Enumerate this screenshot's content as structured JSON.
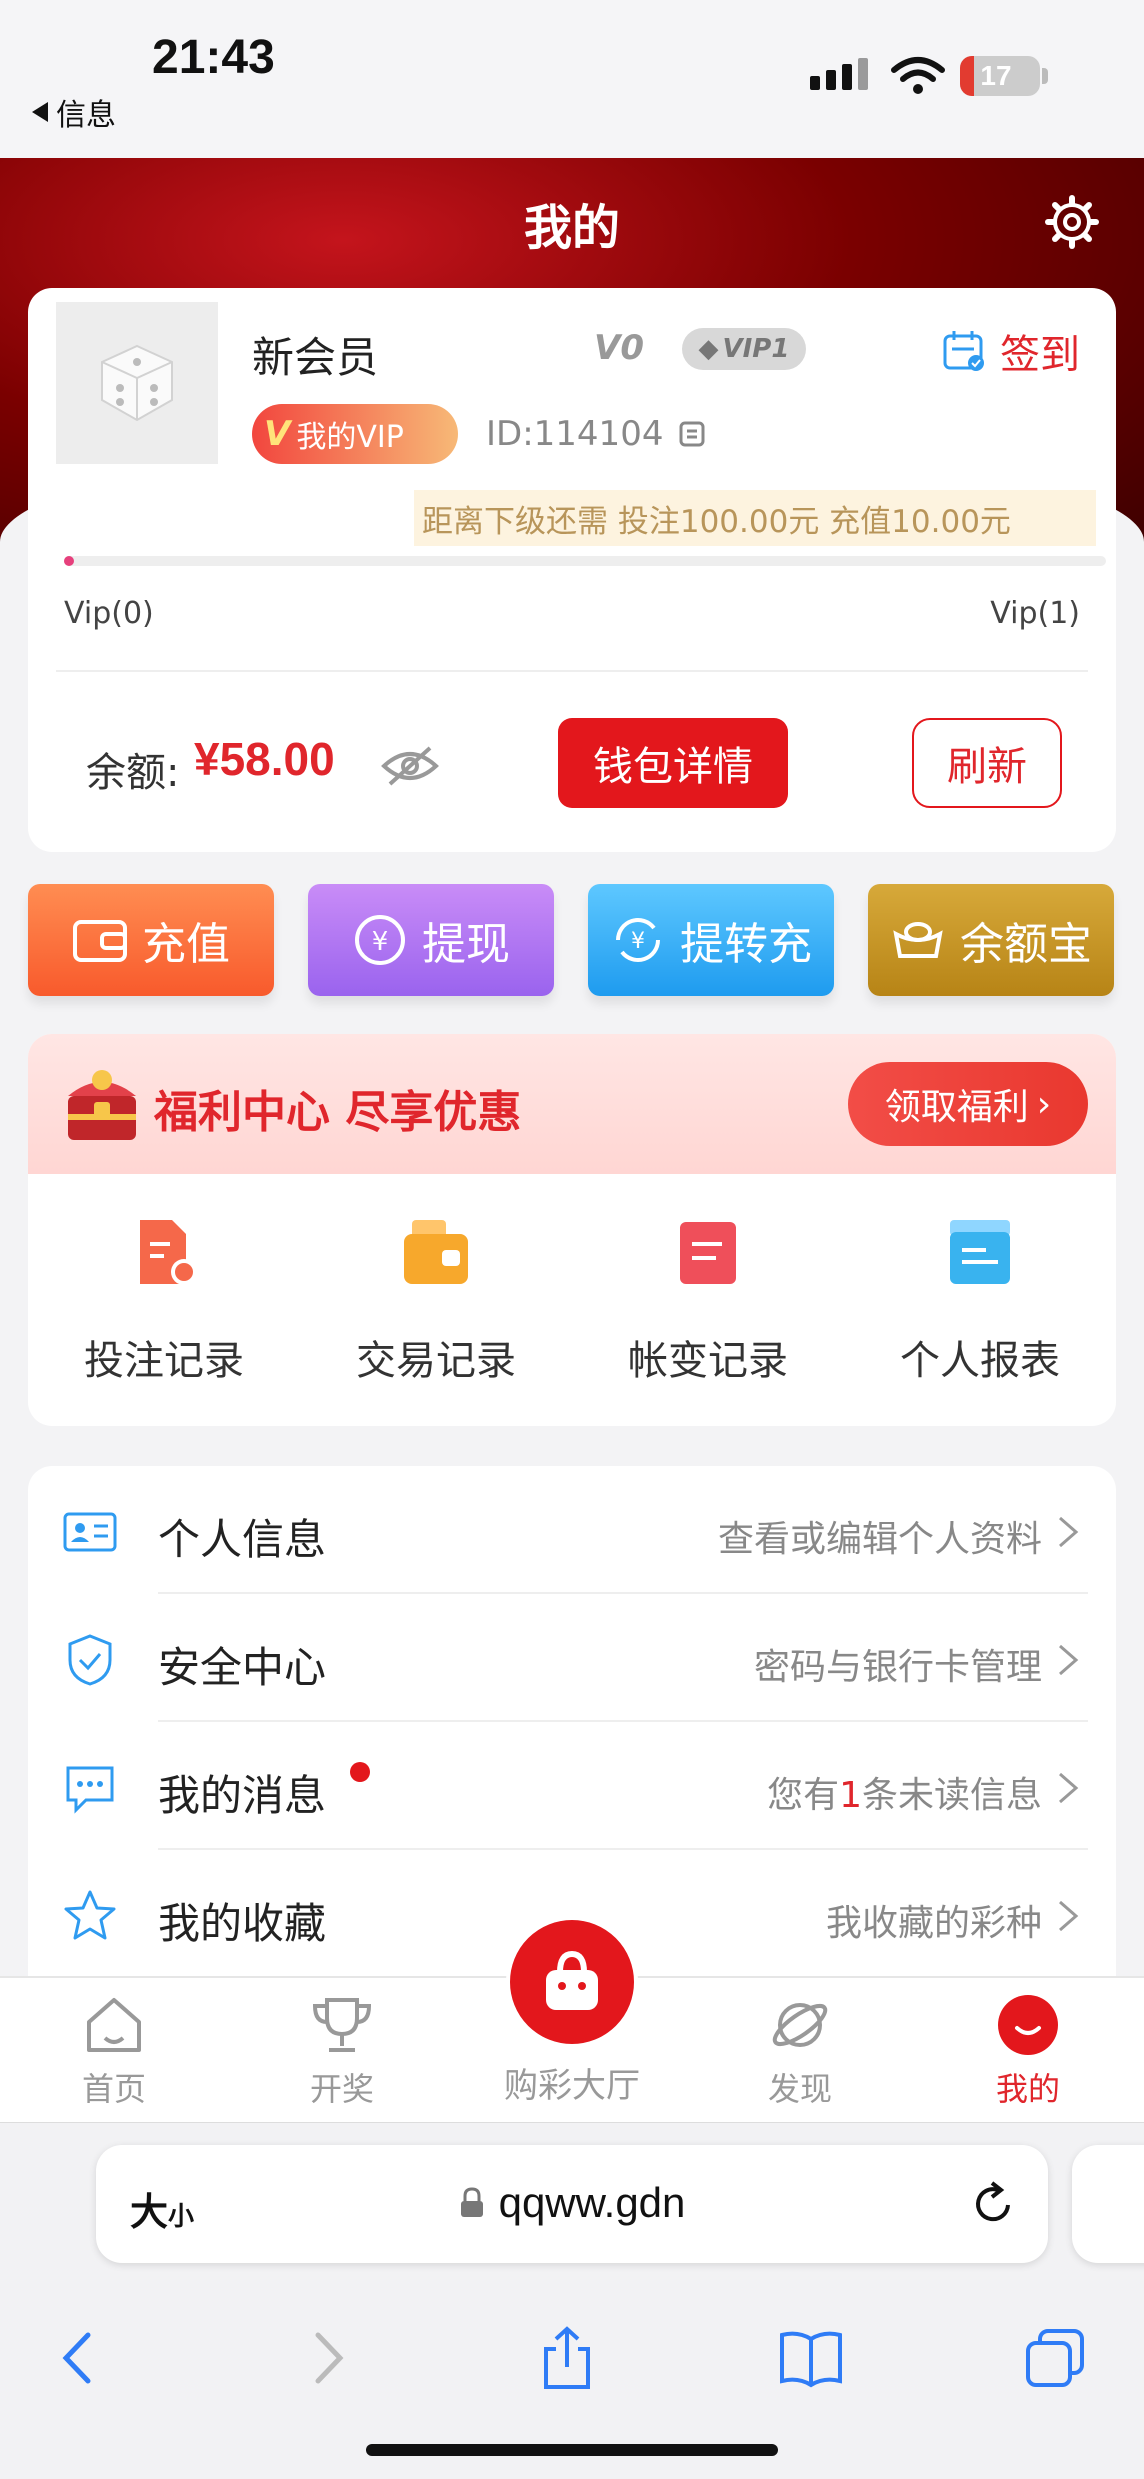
{
  "status_bar": {
    "time": "21:43",
    "back_label": "信息",
    "battery": "17",
    "battery_level": 0.17
  },
  "header": {
    "title": "我的"
  },
  "profile": {
    "nickname": "新会员",
    "level_badge": "V0",
    "vip_badge": "VIP1",
    "checkin_label": "签到",
    "my_vip_label": "我的VIP",
    "user_id": "ID:114104",
    "next_level_text": "距离下级还需  投注100.00元  充值10.00元",
    "progress": 0.01,
    "vip_from": "Vip(0)",
    "vip_to": "Vip(1)",
    "balance_label": "余额:",
    "balance_value": "¥58.00",
    "wallet_button": "钱包详情",
    "refresh_button": "刷新"
  },
  "quick_actions": [
    {
      "label": "充值",
      "icon": "wallet-icon"
    },
    {
      "label": "提现",
      "icon": "withdraw-icon"
    },
    {
      "label": "提转充",
      "icon": "transfer-icon"
    },
    {
      "label": "余额宝",
      "icon": "ingot-icon"
    }
  ],
  "welfare": {
    "title": "福利中心 尽享优惠",
    "button": "领取福利",
    "records": [
      {
        "label": "投注记录",
        "icon": "bet-record-icon",
        "color": "#f5684a"
      },
      {
        "label": "交易记录",
        "icon": "trade-record-icon",
        "color": "#f7a82c"
      },
      {
        "label": "帐变记录",
        "icon": "account-change-icon",
        "color": "#ef4f5a"
      },
      {
        "label": "个人报表",
        "icon": "report-icon",
        "color": "#39b3ef"
      }
    ]
  },
  "menu": [
    {
      "title": "个人信息",
      "desc": "查看或编辑个人资料",
      "icon": "id-card-icon"
    },
    {
      "title": "安全中心",
      "desc": "密码与银行卡管理",
      "icon": "shield-icon"
    },
    {
      "title": "我的消息",
      "desc_prefix": "您有",
      "unread_count": "1",
      "desc_suffix": "条未读信息",
      "icon": "message-icon"
    },
    {
      "title": "我的收藏",
      "desc": "我收藏的彩种",
      "icon": "star-icon"
    }
  ],
  "tabs": [
    {
      "label": "首页",
      "icon": "home-icon"
    },
    {
      "label": "开奖",
      "icon": "trophy-icon"
    },
    {
      "label": "购彩大厅",
      "icon": "shopping-bag-icon"
    },
    {
      "label": "发现",
      "icon": "planet-icon"
    },
    {
      "label": "我的",
      "icon": "profile-icon",
      "active": true
    }
  ],
  "browser": {
    "text_size_big": "大",
    "text_size_small": "小",
    "url": "qqww.gdn"
  },
  "colors": {
    "brand_red": "#e3171c",
    "header_dark": "#7a0000",
    "accent_blue": "#1e9bef"
  }
}
